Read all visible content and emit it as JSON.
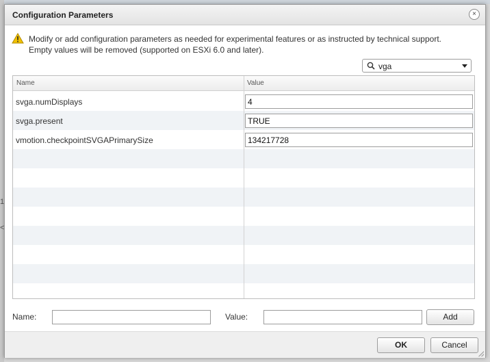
{
  "dialog": {
    "title": "Configuration Parameters",
    "close_glyph": "×"
  },
  "message": {
    "line1": "Modify or add configuration parameters as needed for experimental features or as instructed by technical support.",
    "line2": "Empty values will be removed (supported on ESXi 6.0 and later)."
  },
  "search": {
    "value": "vga"
  },
  "grid": {
    "columns": [
      "Name",
      "Value"
    ],
    "rows": [
      {
        "name": "svga.numDisplays",
        "value": "4"
      },
      {
        "name": "svga.present",
        "value": "TRUE"
      },
      {
        "name": "vmotion.checkpointSVGAPrimarySize",
        "value": "134217728"
      }
    ]
  },
  "form": {
    "name_label": "Name:",
    "value_label": "Value:",
    "add_label": "Add"
  },
  "buttons": {
    "ok": "OK",
    "cancel": "Cancel"
  },
  "background": {
    "edge_marks": [
      "1",
      "<"
    ]
  },
  "colors": {
    "warning": "#f2c200",
    "alt_row": "#f0f3f6"
  }
}
